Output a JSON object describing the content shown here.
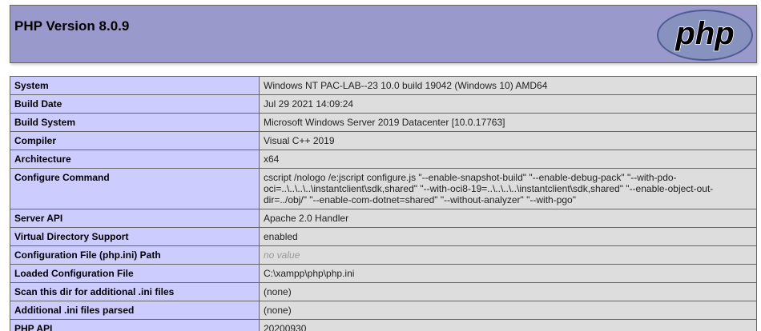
{
  "header": {
    "title": "PHP Version 8.0.9",
    "logo_text": "php"
  },
  "colors": {
    "header_bg": "#9999cc",
    "label_bg": "#ccccff",
    "value_bg": "#dddddd",
    "border": "#666666",
    "logo_fill": "#8892bf"
  },
  "rows": [
    {
      "label": "System",
      "value": "Windows NT PAC-LAB--23 10.0 build 19042 (Windows 10) AMD64"
    },
    {
      "label": "Build Date",
      "value": "Jul 29 2021 14:09:24"
    },
    {
      "label": "Build System",
      "value": "Microsoft Windows Server 2019 Datacenter [10.0.17763]"
    },
    {
      "label": "Compiler",
      "value": "Visual C++ 2019"
    },
    {
      "label": "Architecture",
      "value": "x64"
    },
    {
      "label": "Configure Command",
      "value": "cscript /nologo /e:jscript configure.js \"--enable-snapshot-build\" \"--enable-debug-pack\" \"--with-pdo-oci=..\\..\\..\\..\\instantclient\\sdk,shared\" \"--with-oci8-19=..\\..\\..\\..\\instantclient\\sdk,shared\" \"--enable-object-out-dir=../obj/\" \"--enable-com-dotnet=shared\" \"--without-analyzer\" \"--with-pgo\""
    },
    {
      "label": "Server API",
      "value": "Apache 2.0 Handler"
    },
    {
      "label": "Virtual Directory Support",
      "value": "enabled"
    },
    {
      "label": "Configuration File (php.ini) Path",
      "value": "no value"
    },
    {
      "label": "Loaded Configuration File",
      "value": "C:\\xampp\\php\\php.ini"
    },
    {
      "label": "Scan this dir for additional .ini files",
      "value": "(none)"
    },
    {
      "label": "Additional .ini files parsed",
      "value": "(none)"
    },
    {
      "label": "PHP API",
      "value": "20200930"
    }
  ]
}
